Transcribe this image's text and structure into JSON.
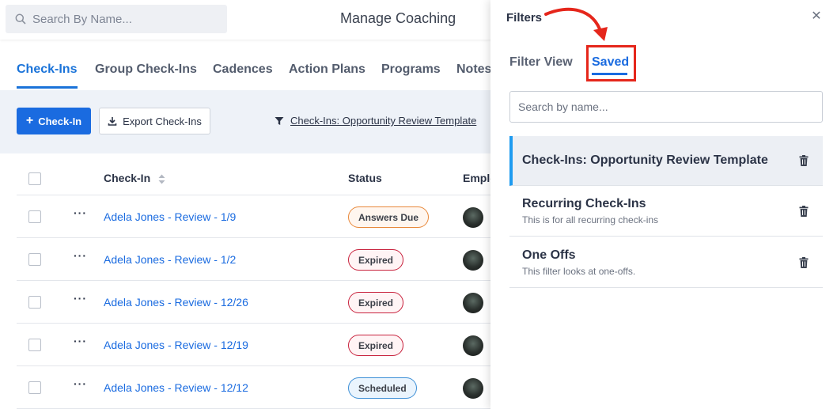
{
  "topbar": {
    "search_placeholder": "Search By Name...",
    "title": "Manage Coaching"
  },
  "tabs": [
    {
      "label": "Check-Ins",
      "active": true
    },
    {
      "label": "Group Check-Ins",
      "active": false
    },
    {
      "label": "Cadences",
      "active": false
    },
    {
      "label": "Action Plans",
      "active": false
    },
    {
      "label": "Programs",
      "active": false
    },
    {
      "label": "Notes",
      "active": false
    }
  ],
  "toolbar": {
    "add_label": "Check-In",
    "export_label": "Export Check-Ins",
    "active_filter": "Check-Ins: Opportunity Review Template"
  },
  "table": {
    "columns": [
      "Check-In",
      "Status",
      "Emplo"
    ],
    "rows": [
      {
        "name": "Adela Jones - Review - 1/9",
        "status": "Answers Due",
        "status_color": "orange"
      },
      {
        "name": "Adela Jones - Review - 1/2",
        "status": "Expired",
        "status_color": "red"
      },
      {
        "name": "Adela Jones - Review - 12/26",
        "status": "Expired",
        "status_color": "red"
      },
      {
        "name": "Adela Jones - Review - 12/19",
        "status": "Expired",
        "status_color": "red"
      },
      {
        "name": "Adela Jones - Review - 12/12",
        "status": "Scheduled",
        "status_color": "blue"
      }
    ]
  },
  "drawer": {
    "title": "Filters",
    "close_icon": "close-icon",
    "tabs": [
      {
        "label": "Filter View",
        "active": false
      },
      {
        "label": "Saved",
        "active": true
      }
    ],
    "search_placeholder": "Search by name...",
    "saved_filters": [
      {
        "name": "Check-Ins: Opportunity Review Template",
        "description": "",
        "selected": true
      },
      {
        "name": "Recurring Check-Ins",
        "description": "This is for all recurring check-ins",
        "selected": false
      },
      {
        "name": "One Offs",
        "description": "This filter looks at one-offs.",
        "selected": false
      }
    ]
  },
  "colors": {
    "accent": "#1a6be0",
    "annotation": "#e5261b",
    "selected_bar": "#1e9bf0"
  }
}
